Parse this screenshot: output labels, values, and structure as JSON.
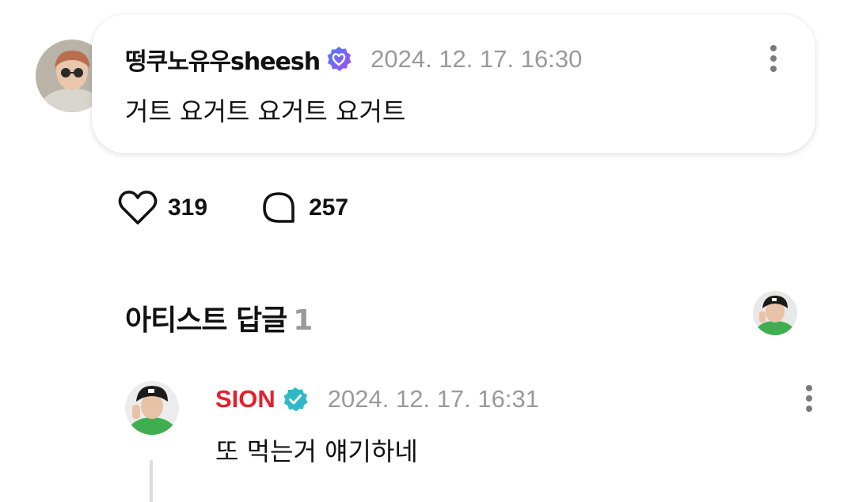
{
  "comment": {
    "username": "떵쿠노유우sheesh",
    "timestamp": "2024. 12. 17. 16:30",
    "text": "거트 요거트 요거트 요거트",
    "likes": "319",
    "replies": "257"
  },
  "artist_section": {
    "title": "아티스트 답글",
    "count": "1"
  },
  "artist_reply": {
    "username": "SION",
    "timestamp": "2024. 12. 17. 16:31",
    "text": "또 먹는거 얘기하네"
  },
  "icons": {
    "more": "more-vertical-icon",
    "like": "heart-icon",
    "reply": "speech-bubble-icon",
    "fan_badge": "heart-badge-icon",
    "artist_badge": "verified-check-icon"
  },
  "colors": {
    "artist_name": "#e3222e",
    "verified_badge": "#2fb8c6",
    "fan_badge": "#7b5cf5",
    "muted_text": "#9a9a9a"
  }
}
